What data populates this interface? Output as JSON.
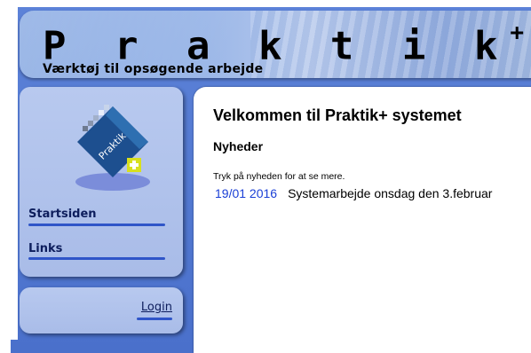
{
  "header": {
    "title": "P r a k t i k",
    "title_plus": "+",
    "subtitle": "Værktøj til opsøgende arbejde"
  },
  "nav": {
    "logo_text": "Praktik",
    "items": [
      {
        "label": "Startsiden"
      },
      {
        "label": "Links"
      }
    ]
  },
  "login": {
    "label": "Login"
  },
  "main": {
    "title": "Velkommen til Praktik+ systemet",
    "news_heading": "Nyheder",
    "hint": "Tryk på nyheden for at se mere.",
    "news": [
      {
        "date": "19/01 2016",
        "text": "Systemarbejde onsdag den 3.februar"
      }
    ]
  },
  "colors": {
    "frame_blue": "#4a70cb",
    "card_blue": "#b8c9ef",
    "link_blue": "#1a3fd6",
    "nav_text": "#0d1d5c"
  }
}
